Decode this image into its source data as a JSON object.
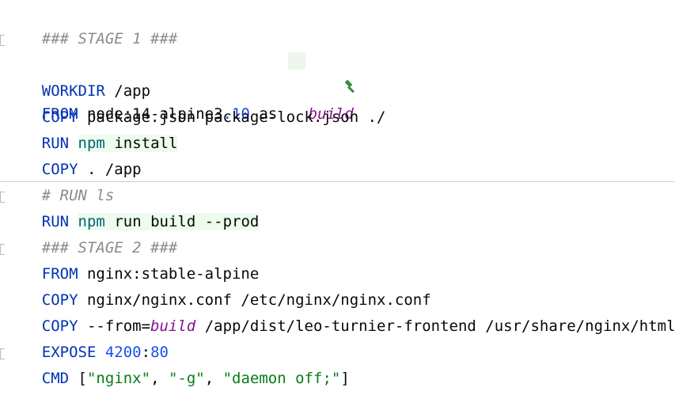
{
  "editor": {
    "lines": {
      "l1": {
        "comment": "### STAGE 1 ###"
      },
      "l2": {
        "kw": "FROM",
        "image": " node:14-alpine3",
        "ver": ".10",
        "as": " as ",
        "stage": "build"
      },
      "l3": {
        "kw": "WORKDIR",
        "rest": " /app"
      },
      "l4": {
        "kw": "COPY",
        "rest": " package.json package-lock.json ./"
      },
      "l5": {
        "kw": "RUN",
        "sp": " ",
        "npm": "npm",
        "rest": " install"
      },
      "l6": {
        "kw": "COPY",
        "rest": " . /app"
      },
      "l7": {
        "comment": "# RUN ls"
      },
      "l8": {
        "kw": "RUN",
        "sp": " ",
        "npm": "npm",
        "rest": " run build --prod"
      },
      "l9": {
        "comment": "### STAGE 2 ###"
      },
      "l10": {
        "kw": "FROM",
        "rest": " nginx:stable-alpine"
      },
      "l11": {
        "kw": "COPY",
        "rest": " nginx/nginx.conf /etc/nginx/nginx.conf"
      },
      "l12": {
        "kw": "COPY",
        "flag": " --from=",
        "stage": "build",
        "rest": " /app/dist/leo-turnier-frontend /usr/share/nginx/html"
      },
      "l13": {
        "kw": "EXPOSE",
        "sp": " ",
        "port1": "4200",
        "colon": ":",
        "port2": "80"
      },
      "l14": {
        "kw": "CMD",
        "open": " [",
        "s1": "\"nginx\"",
        "comma1": ", ",
        "s2": "\"-g\"",
        "comma2": ", ",
        "s3": "\"daemon off;\"",
        "close": "]"
      }
    },
    "icons": {
      "stage_marker": "hammer-icon"
    },
    "colors": {
      "keyword": "#0033b3",
      "comment": "#8c8c8c",
      "number": "#1750eb",
      "string": "#067d17",
      "stage": "#871094",
      "highlight": "#edfced"
    }
  }
}
